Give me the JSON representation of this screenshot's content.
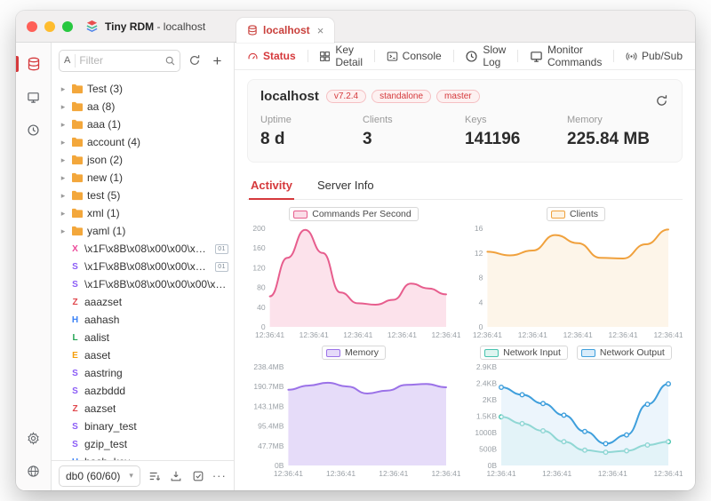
{
  "titlebar": {
    "app_name": "Tiny RDM",
    "app_subtitle": "- localhost"
  },
  "tab": {
    "label": "localhost",
    "close": "×"
  },
  "toolbar": {
    "tabs": [
      {
        "label": "Status",
        "icon": "gauge",
        "active": true
      },
      {
        "label": "Key Detail",
        "icon": "grid",
        "active": false
      },
      {
        "label": "Console",
        "icon": "terminal",
        "active": false
      },
      {
        "label": "Slow Log",
        "icon": "clock",
        "active": false
      },
      {
        "label": "Monitor Commands",
        "icon": "monitor",
        "active": false
      },
      {
        "label": "Pub/Sub",
        "icon": "broadcast",
        "active": false
      }
    ]
  },
  "browser": {
    "filter": {
      "match_label": "A",
      "placeholder": "Filter"
    },
    "folders": [
      {
        "label": "Test",
        "count": 3
      },
      {
        "label": "aa",
        "count": 8
      },
      {
        "label": "aaa",
        "count": 1
      },
      {
        "label": "account",
        "count": 4
      },
      {
        "label": "json",
        "count": 2
      },
      {
        "label": "new",
        "count": 1
      },
      {
        "label": "test",
        "count": 5
      },
      {
        "label": "xml",
        "count": 1
      },
      {
        "label": "yaml",
        "count": 1
      }
    ],
    "keys": [
      {
        "type": "X",
        "name": "\\x1F\\x8B\\x08\\x00\\x00\\x00\\x00\\x0...",
        "binary": true
      },
      {
        "type": "S",
        "name": "\\x1F\\x8B\\x08\\x00\\x00\\x09\\x8...",
        "binary": true
      },
      {
        "type": "S",
        "name": "\\x1F\\x8B\\x08\\x00\\x00\\x00\\x00\\x0...",
        "binary": false
      },
      {
        "type": "Z",
        "name": "aaazset",
        "binary": false
      },
      {
        "type": "H",
        "name": "aahash",
        "binary": false
      },
      {
        "type": "L",
        "name": "aalist",
        "binary": false
      },
      {
        "type": "E",
        "name": "aaset",
        "binary": false
      },
      {
        "type": "S",
        "name": "aastring",
        "binary": false
      },
      {
        "type": "S",
        "name": "aazbddd",
        "binary": false
      },
      {
        "type": "Z",
        "name": "aazset",
        "binary": false
      },
      {
        "type": "S",
        "name": "binary_test",
        "binary": false
      },
      {
        "type": "S",
        "name": "gzip_test",
        "binary": false
      },
      {
        "type": "H",
        "name": "hash_key",
        "binary": false
      }
    ],
    "db_select": "db0 (60/60)"
  },
  "server": {
    "name": "localhost",
    "badges": [
      "v7.2.4",
      "standalone",
      "master"
    ],
    "stats": [
      {
        "label": "Uptime",
        "value": "8 d"
      },
      {
        "label": "Clients",
        "value": "3"
      },
      {
        "label": "Keys",
        "value": "141196"
      },
      {
        "label": "Memory",
        "value": "225.84 MB"
      }
    ]
  },
  "activity_tabs": [
    {
      "label": "Activity",
      "active": true
    },
    {
      "label": "Server Info",
      "active": false
    }
  ],
  "colors": {
    "accent_red": "#d5393c",
    "traffic": [
      "#ff5f57",
      "#febc2e",
      "#28c840"
    ],
    "key_types": {
      "X": "#ec4899",
      "S": "#8b5cf6",
      "Z": "#e0484d",
      "H": "#3b82f6",
      "L": "#22a453",
      "E": "#f59e0b"
    }
  },
  "chart_data": [
    {
      "type": "area",
      "title": "Commands Per Second",
      "x": [
        "12:36:41",
        "12:36:41",
        "12:36:41",
        "12:36:41",
        "12:36:41"
      ],
      "yticks": [
        "0",
        "40",
        "80",
        "120",
        "160",
        "200"
      ],
      "ylim": [
        0,
        200
      ],
      "legend_position": "top",
      "grid": false,
      "series": [
        {
          "name": "Commands Per Second",
          "color": "#e75d8d",
          "fill": "#fbdde8",
          "fill_opacity": 0.85,
          "values": [
            62,
            140,
            197,
            150,
            70,
            48,
            45,
            55,
            88,
            78,
            66
          ]
        }
      ]
    },
    {
      "type": "area",
      "title": "Clients",
      "x": [
        "12:36:41",
        "12:36:41",
        "12:36:41",
        "12:36:41",
        "12:36:41"
      ],
      "yticks": [
        "0",
        "4",
        "8",
        "12",
        "16"
      ],
      "ylim": [
        0,
        16
      ],
      "legend_position": "top",
      "grid": false,
      "series": [
        {
          "name": "Clients",
          "color": "#f0a13d",
          "fill": "#fdf3e3",
          "fill_opacity": 0.8,
          "values": [
            12.2,
            11.6,
            12.4,
            14.9,
            13.6,
            11.2,
            11.1,
            13.4,
            15.8
          ]
        }
      ]
    },
    {
      "type": "area",
      "title": "Memory",
      "x": [
        "12:36:41",
        "12:36:41",
        "12:36:41",
        "12:36:41"
      ],
      "yticks": [
        "0B",
        "47.7MB",
        "95.4MB",
        "143.1MB",
        "190.7MB",
        "238.4MB"
      ],
      "ylim": [
        0,
        238.4
      ],
      "legend_position": "top",
      "grid": false,
      "series": [
        {
          "name": "Memory",
          "color": "#9b72e8",
          "fill": "#e5daf9",
          "fill_opacity": 0.95,
          "values": [
            183,
            193,
            200,
            191,
            174,
            181,
            195,
            197,
            189
          ]
        }
      ]
    },
    {
      "type": "line",
      "title": "Network",
      "markers": true,
      "x": [
        "12:36:41",
        "12:36:41",
        "12:36:41",
        "12:36:41"
      ],
      "yticks": [
        "0B",
        "500B",
        "1000B",
        "1.5KB",
        "2KB",
        "2.4KB",
        "2.9KB"
      ],
      "ylim": [
        0,
        2900
      ],
      "legend_position": "top",
      "grid": false,
      "series": [
        {
          "name": "Network Input",
          "color": "#46c3ae",
          "fill": "#def5f0",
          "fill_opacity": 0.55,
          "values": [
            1430,
            1230,
            1020,
            700,
            450,
            390,
            430,
            600,
            700
          ]
        },
        {
          "name": "Network Output",
          "color": "#3f9fdc",
          "fill": "#d9ecfa",
          "fill_opacity": 0.5,
          "values": [
            2300,
            2080,
            1820,
            1480,
            1000,
            640,
            900,
            1800,
            2400
          ]
        }
      ]
    }
  ]
}
